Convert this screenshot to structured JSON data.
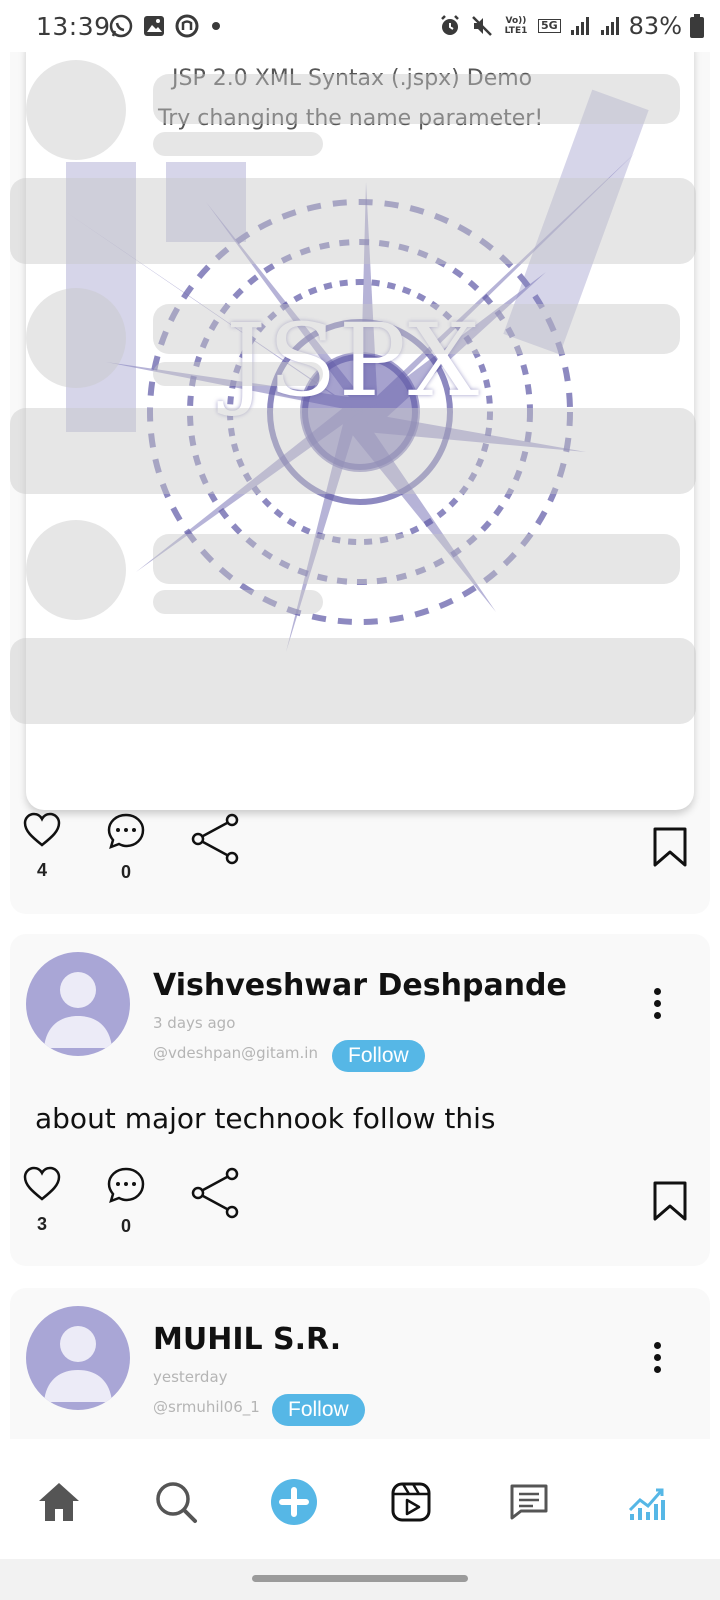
{
  "status_bar": {
    "time": "13:39",
    "network_label": "Vo)) LTE1",
    "network_5g": "5G",
    "battery": "83%"
  },
  "media": {
    "title_line1": "JSP 2.0 XML Syntax (.jspx) Demo",
    "title_line2": "Try changing the name parameter!",
    "logo_text": "JSPX"
  },
  "posts": [
    {
      "likes": "4",
      "comments": "0"
    },
    {
      "author": "Vishveshwar Deshpande",
      "time": "3 days ago",
      "handle": "@vdeshpan@gitam.in",
      "follow_label": "Follow",
      "text": "about major technook follow this",
      "likes": "3",
      "comments": "0"
    },
    {
      "author": "MUHIL S.R.",
      "time": "yesterday",
      "handle": "@srmuhil06_1",
      "follow_label": "Follow"
    }
  ],
  "nav": {
    "items": [
      "home-icon",
      "search-icon",
      "add-post-icon",
      "reels-icon",
      "messages-icon",
      "analytics-icon"
    ],
    "accent": "#56b7e6",
    "icon_color": "#555555"
  }
}
